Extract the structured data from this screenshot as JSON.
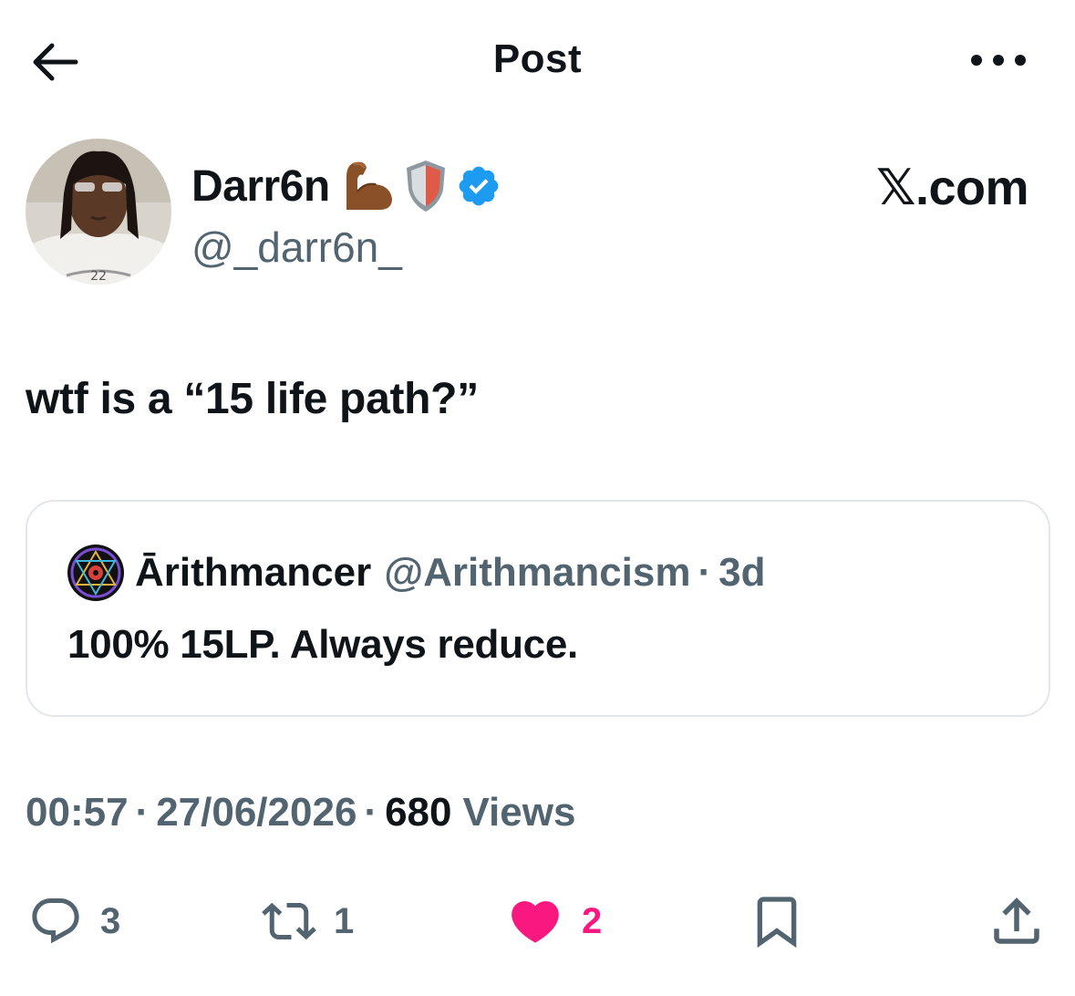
{
  "header": {
    "title": "Post",
    "back_icon": "arrow-left-icon",
    "more_icon": "ellipsis-icon"
  },
  "author": {
    "display_name": "Darr6n",
    "handle": "@_darr6n_",
    "source": "𝕏.com",
    "badges": [
      "flexed-biceps-emoji",
      "shield-emoji",
      "verified-badge-icon"
    ],
    "verified_color": "#1d9bf0"
  },
  "tweet": {
    "text": "wtf is a “15 life path?”"
  },
  "quote": {
    "name": "Ārithmancer",
    "handle": "@Arithmancism",
    "separator": "·",
    "time": "3d",
    "text": "100% 15LP. Always reduce."
  },
  "meta": {
    "time": "00:57",
    "separator": "·",
    "date": "27/06/2026",
    "views_count": "680",
    "views_label": "Views"
  },
  "actions": {
    "replies": "3",
    "reposts": "1",
    "likes": "2",
    "like_color": "#f91880",
    "muted_color": "#536471"
  }
}
